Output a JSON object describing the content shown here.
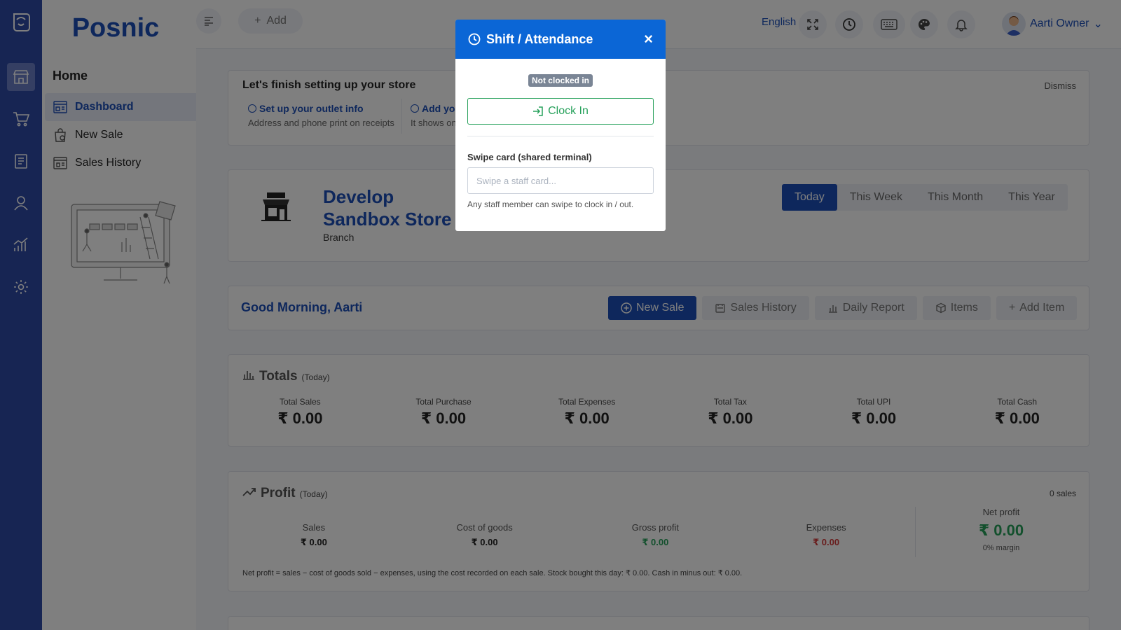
{
  "app": {
    "brand": "Posnic"
  },
  "sidebar": {
    "title": "Home",
    "items": [
      {
        "label": "Dashboard"
      },
      {
        "label": "New Sale"
      },
      {
        "label": "Sales History"
      }
    ]
  },
  "topbar": {
    "add_label": "Add",
    "language": "English",
    "user_name": "Aarti Owner"
  },
  "setup": {
    "title": "Let's finish setting up your store",
    "dismiss": "Dismiss",
    "steps": [
      {
        "title": "Set up your outlet info",
        "desc": "Address and phone print on receipts"
      },
      {
        "title": "Add yo",
        "desc": "It shows on"
      }
    ]
  },
  "store": {
    "name": "Develop Sandbox Store",
    "type": "Branch",
    "periods": [
      "Today",
      "This Week",
      "This Month",
      "This Year"
    ]
  },
  "greeting": {
    "text": "Good Morning, Aarti",
    "actions": [
      "New Sale",
      "Sales History",
      "Daily Report",
      "Items",
      "Add Item"
    ]
  },
  "totals": {
    "title": "Totals",
    "period": "(Today)",
    "items": [
      {
        "label": "Total Sales",
        "value": "₹ 0.00"
      },
      {
        "label": "Total Purchase",
        "value": "₹ 0.00"
      },
      {
        "label": "Total Expenses",
        "value": "₹ 0.00"
      },
      {
        "label": "Total Tax",
        "value": "₹ 0.00"
      },
      {
        "label": "Total UPI",
        "value": "₹ 0.00"
      },
      {
        "label": "Total Cash",
        "value": "₹ 0.00"
      }
    ]
  },
  "profit": {
    "title": "Profit",
    "period": "(Today)",
    "count": "0 sales",
    "items": [
      {
        "label": "Sales",
        "value": "₹ 0.00"
      },
      {
        "label": "Cost of goods",
        "value": "₹ 0.00"
      },
      {
        "label": "Gross profit",
        "value": "₹ 0.00"
      },
      {
        "label": "Expenses",
        "value": "₹ 0.00"
      }
    ],
    "net": {
      "label": "Net profit",
      "value": "₹ 0.00",
      "margin": "0% margin"
    },
    "note": "Net profit = sales − cost of goods sold − expenses, using the cost recorded on each sale. Stock bought this day: ₹ 0.00. Cash in minus out: ₹ 0.00."
  },
  "modal": {
    "title": "Shift / Attendance",
    "close": "×",
    "status": "Not clocked in",
    "clock_in": "Clock In",
    "swipe_label": "Swipe card (shared terminal)",
    "swipe_placeholder": "Swipe a staff card...",
    "help": "Any staff member can swipe to clock in / out."
  },
  "colors": {
    "primary": "#1c4fb8",
    "rail": "#2f4aa6",
    "modal_header": "#0b66d6",
    "success": "#27a15b",
    "danger": "#d23b3b"
  }
}
